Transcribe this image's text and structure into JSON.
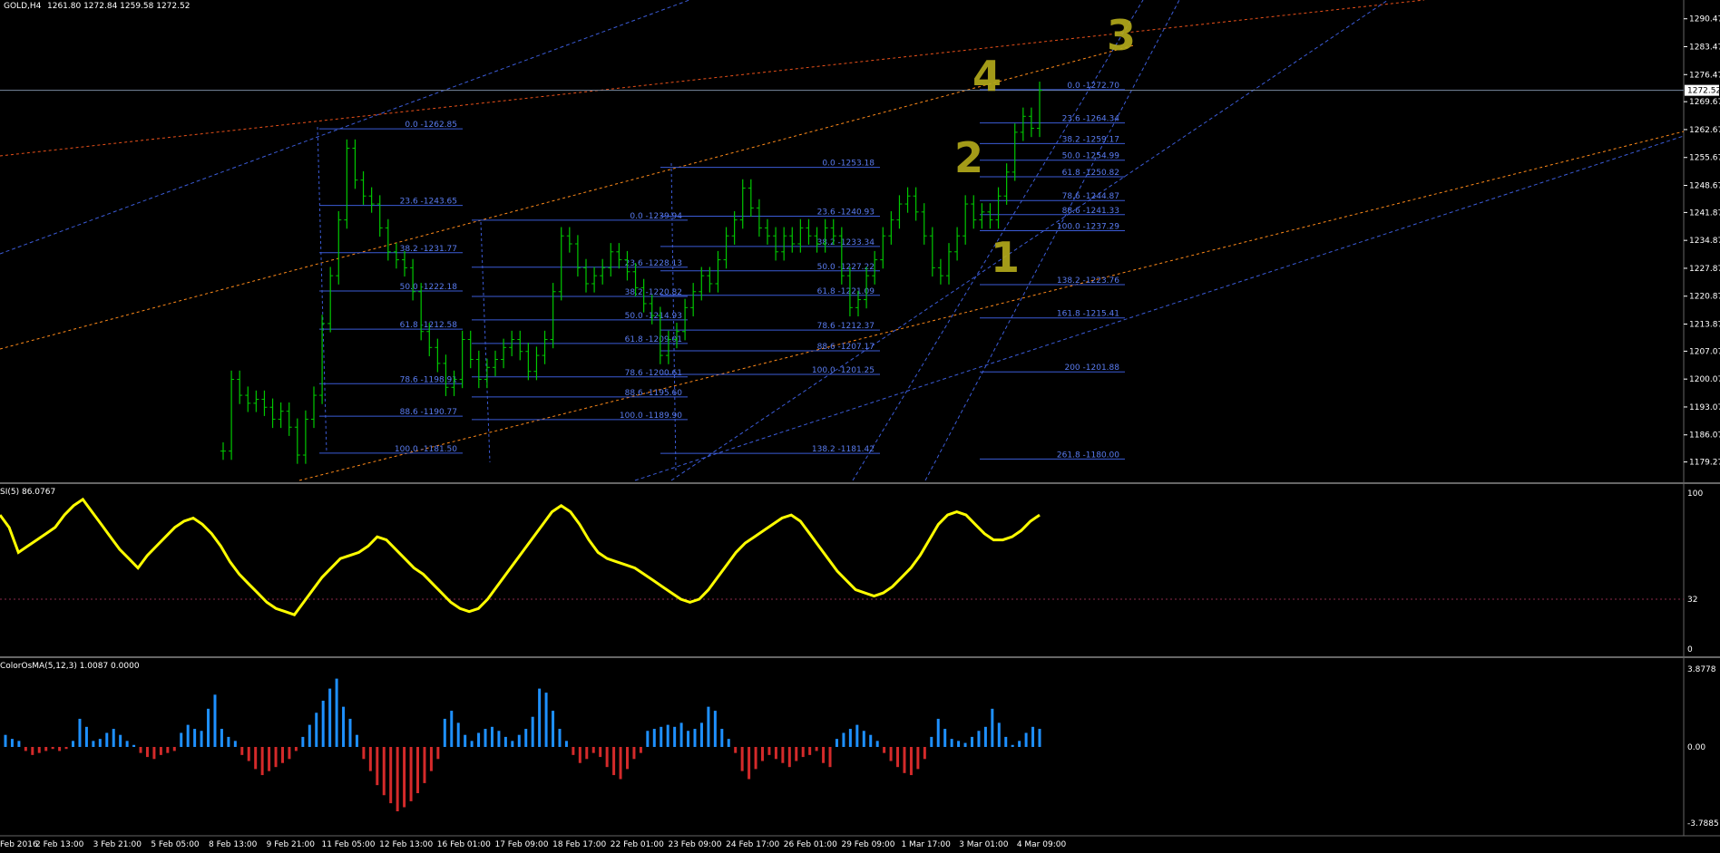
{
  "header": {
    "symbol": "GOLD,H4",
    "ohlc": "1261.80 1272.84 1259.58 1272.52"
  },
  "colors": {
    "background": "#000000",
    "bull_candle": "#00c800",
    "fib_line": "#3b5bd6",
    "fib_text": "#5a7cf0",
    "channel_blue": "#3b5bd6",
    "channel_orange": "#ff8a1a",
    "channel_red": "#e8501a",
    "rsi_line": "#ffff00",
    "osma_pos": "#1e90ff",
    "osma_neg": "#d42a2a",
    "annotation": "#b5ac1b",
    "axis_text": "#ffffff"
  },
  "chart_data": [
    {
      "type": "candlestick",
      "title": "GOLD,H4",
      "ohlc_text": "1261.80 1272.84 1259.58 1272.52",
      "ylim": [
        1176.0,
        1292.0
      ],
      "price_ticks": [
        "1290.47",
        "1283.47",
        "1276.47",
        "1269.67",
        "1262.67",
        "1255.67",
        "1248.67",
        "1241.87",
        "1234.87",
        "1227.87",
        "1220.87",
        "1213.87",
        "1207.07",
        "1200.07",
        "1193.07",
        "1186.07",
        "1179.27"
      ],
      "current_price": "1272.52",
      "time_labels": [
        "Feb 2016",
        "2 Feb 13:00",
        "3 Feb 21:00",
        "5 Feb 05:00",
        "8 Feb 13:00",
        "9 Feb 21:00",
        "11 Feb 05:00",
        "12 Feb 13:00",
        "16 Feb 01:00",
        "17 Feb 09:00",
        "18 Feb 17:00",
        "22 Feb 01:00",
        "23 Feb 09:00",
        "24 Feb 17:00",
        "26 Feb 01:00",
        "29 Feb 09:00",
        "1 Mar 17:00",
        "3 Mar 01:00",
        "4 Mar 09:00"
      ],
      "closes": [
        1182,
        1200,
        1196,
        1194,
        1195,
        1193,
        1190,
        1192,
        1188,
        1181,
        1190,
        1196,
        1214,
        1226,
        1240,
        1258,
        1250,
        1246,
        1244,
        1238,
        1232,
        1230,
        1228,
        1222,
        1212,
        1208,
        1204,
        1198,
        1200,
        1210,
        1205,
        1200,
        1203,
        1205,
        1208,
        1210,
        1207,
        1202,
        1206,
        1210,
        1222,
        1236,
        1234,
        1228,
        1224,
        1226,
        1228,
        1232,
        1230,
        1227,
        1223,
        1219,
        1216,
        1206,
        1210,
        1212,
        1218,
        1222,
        1226,
        1224,
        1230,
        1236,
        1240,
        1248,
        1243,
        1238,
        1236,
        1232,
        1236,
        1234,
        1238,
        1236,
        1234,
        1238,
        1236,
        1226,
        1218,
        1220,
        1226,
        1230,
        1236,
        1240,
        1244,
        1246,
        1242,
        1236,
        1228,
        1226,
        1232,
        1236,
        1244,
        1240,
        1242,
        1240,
        1246,
        1252,
        1262,
        1266,
        1263,
        1272.5
      ],
      "fib_levels": [
        {
          "ratio": "0.0",
          "value": "1262.85"
        },
        {
          "ratio": "23.6",
          "value": "1243.65"
        },
        {
          "ratio": "38.2",
          "value": "1231.77"
        },
        {
          "ratio": "50.0",
          "value": "1222.18"
        },
        {
          "ratio": "61.8",
          "value": "1212.58"
        },
        {
          "ratio": "78.6",
          "value": "1198.91"
        },
        {
          "ratio": "88.6",
          "value": "1190.77"
        },
        {
          "ratio": "100.0",
          "value": "1181.50"
        },
        {
          "ratio": "0.0",
          "value": "1239.94"
        },
        {
          "ratio": "23.6",
          "value": "1228.13"
        },
        {
          "ratio": "38.2",
          "value": "1220.82"
        },
        {
          "ratio": "50.0",
          "value": "1214.93"
        },
        {
          "ratio": "61.8",
          "value": "1209.01"
        },
        {
          "ratio": "78.6",
          "value": "1200.61"
        },
        {
          "ratio": "88.6",
          "value": "1195.60"
        },
        {
          "ratio": "100.0",
          "value": "1189.90"
        },
        {
          "ratio": "0.0",
          "value": "1253.18"
        },
        {
          "ratio": "23.6",
          "value": "1240.93"
        },
        {
          "ratio": "38.2",
          "value": "1233.34"
        },
        {
          "ratio": "50.0",
          "value": "1227.22"
        },
        {
          "ratio": "61.8",
          "value": "1221.09"
        },
        {
          "ratio": "78.6",
          "value": "1212.37"
        },
        {
          "ratio": "88.6",
          "value": "1207.17"
        },
        {
          "ratio": "100.0",
          "value": "1201.25"
        },
        {
          "ratio": "138.2",
          "value": "1181.42"
        },
        {
          "ratio": "0.0",
          "value": "1272.70"
        },
        {
          "ratio": "23.6",
          "value": "1264.34"
        },
        {
          "ratio": "38.2",
          "value": "1259.17"
        },
        {
          "ratio": "50.0",
          "value": "1254.99"
        },
        {
          "ratio": "61.8",
          "value": "1250.82"
        },
        {
          "ratio": "78.6",
          "value": "1244.87"
        },
        {
          "ratio": "88.6",
          "value": "1241.33"
        },
        {
          "ratio": "100.0",
          "value": "1237.29"
        },
        {
          "ratio": "138.2",
          "value": "1223.76"
        },
        {
          "ratio": "161.8",
          "value": "1215.41"
        },
        {
          "ratio": "200",
          "value": "1201.88"
        },
        {
          "ratio": "261.8",
          "value": "1180.00"
        }
      ],
      "annotations": [
        "3",
        "4",
        "2",
        "1"
      ]
    },
    {
      "type": "line",
      "title": "SI(5) 86.0767",
      "ylim": [
        0,
        100
      ],
      "ticks": [
        "100",
        "32",
        "0"
      ],
      "level": 32,
      "values": [
        86,
        78,
        62,
        66,
        70,
        74,
        78,
        86,
        92,
        96,
        88,
        80,
        72,
        64,
        58,
        52,
        60,
        66,
        72,
        78,
        82,
        84,
        80,
        74,
        66,
        56,
        48,
        42,
        36,
        30,
        26,
        24,
        22,
        30,
        38,
        46,
        52,
        58,
        60,
        62,
        66,
        72,
        70,
        64,
        58,
        52,
        48,
        42,
        36,
        30,
        26,
        24,
        26,
        32,
        40,
        48,
        56,
        64,
        72,
        80,
        88,
        92,
        88,
        80,
        70,
        62,
        58,
        56,
        54,
        52,
        48,
        44,
        40,
        36,
        32,
        30,
        32,
        38,
        46,
        54,
        62,
        68,
        72,
        76,
        80,
        84,
        86,
        82,
        74,
        66,
        58,
        50,
        44,
        38,
        36,
        34,
        36,
        40,
        46,
        52,
        60,
        70,
        80,
        86,
        88,
        86,
        80,
        74,
        70,
        70,
        72,
        76,
        82,
        86
      ]
    },
    {
      "type": "bar",
      "title": "ColorOsMA(5,12,3) 1.0087 0.0000",
      "ylim": [
        -3.7885,
        3.8778
      ],
      "ticks": [
        "3.8778",
        "0.00",
        "-3.7885"
      ],
      "values": [
        0.6,
        0.4,
        0.3,
        -0.2,
        -0.4,
        -0.3,
        -0.2,
        -0.1,
        -0.2,
        -0.1,
        0.3,
        1.4,
        1.0,
        0.3,
        0.4,
        0.7,
        0.9,
        0.6,
        0.3,
        0.1,
        -0.3,
        -0.5,
        -0.6,
        -0.4,
        -0.3,
        -0.2,
        0.7,
        1.1,
        0.9,
        0.8,
        1.9,
        2.6,
        0.9,
        0.5,
        0.3,
        -0.4,
        -0.7,
        -1.1,
        -1.4,
        -1.2,
        -1.0,
        -0.8,
        -0.6,
        -0.2,
        0.5,
        1.1,
        1.7,
        2.3,
        2.9,
        3.4,
        2.0,
        1.4,
        0.6,
        -0.6,
        -1.2,
        -1.9,
        -2.4,
        -2.8,
        -3.2,
        -3.0,
        -2.7,
        -2.3,
        -1.8,
        -1.2,
        -0.6,
        1.4,
        1.8,
        1.2,
        0.6,
        0.3,
        0.7,
        0.9,
        1.0,
        0.8,
        0.5,
        0.3,
        0.6,
        0.9,
        1.5,
        2.9,
        2.7,
        1.8,
        0.9,
        0.3,
        -0.4,
        -0.8,
        -0.6,
        -0.3,
        -0.5,
        -1.0,
        -1.4,
        -1.6,
        -1.1,
        -0.6,
        -0.3,
        0.8,
        0.9,
        1.0,
        1.1,
        1.0,
        1.2,
        0.8,
        0.9,
        1.2,
        2.0,
        1.8,
        0.9,
        0.4,
        -0.3,
        -1.2,
        -1.6,
        -1.1,
        -0.7,
        -0.4,
        -0.6,
        -0.8,
        -1.0,
        -0.7,
        -0.5,
        -0.4,
        -0.2,
        -0.8,
        -1.0,
        0.4,
        0.7,
        0.9,
        1.1,
        0.8,
        0.6,
        0.3,
        -0.3,
        -0.7,
        -1.0,
        -1.3,
        -1.4,
        -1.1,
        -0.6,
        0.5,
        1.4,
        0.9,
        0.4,
        0.3,
        0.2,
        0.5,
        0.8,
        1.0,
        1.9,
        1.2,
        0.5,
        0.1,
        0.3,
        0.7,
        1.0,
        0.9
      ]
    }
  ]
}
